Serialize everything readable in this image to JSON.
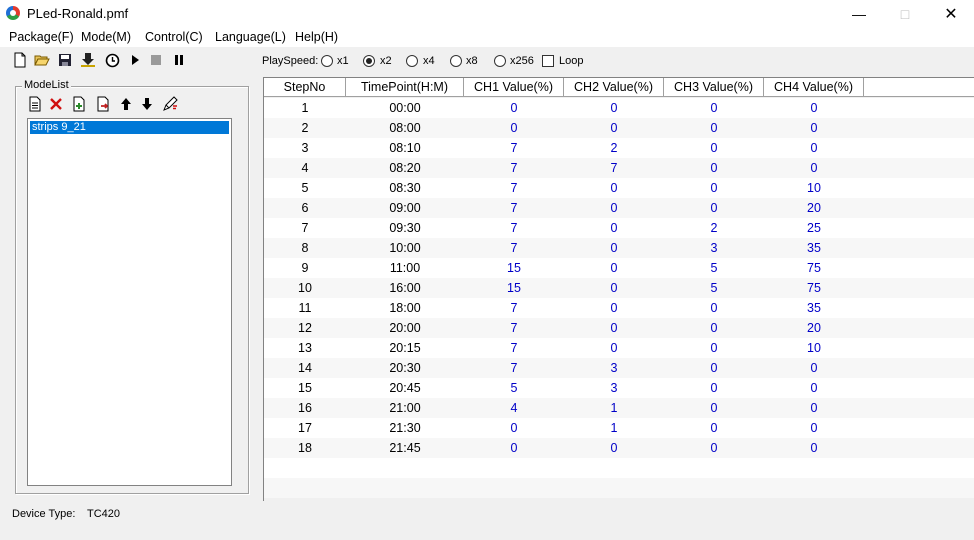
{
  "window": {
    "title": "PLed-Ronald.pmf",
    "min_glyph": "—",
    "max_glyph": "□",
    "close_glyph": "✕"
  },
  "menu": [
    "Package(F)",
    "Mode(M)",
    "Control(C)",
    "Language(L)",
    "Help(H)"
  ],
  "toolbar": {
    "icons": [
      "new-file-icon",
      "open-folder-icon",
      "save-icon",
      "download-icon",
      "timer-icon",
      "play-icon",
      "stop-icon",
      "pause-icon"
    ],
    "playspeed_label": "PlaySpeed:",
    "speeds": [
      "x1",
      "x2",
      "x4",
      "x8",
      "x256"
    ],
    "selected_speed": "x2",
    "loop_label": "Loop",
    "loop_checked": false
  },
  "modelist": {
    "title": "ModeList",
    "tools": [
      "new-mode-icon",
      "delete-icon",
      "import-icon",
      "export-icon",
      "move-up-icon",
      "move-down-icon",
      "edit-icon"
    ],
    "items": [
      "strips 9_21"
    ],
    "selected_index": 0
  },
  "table": {
    "columns": [
      "StepNo",
      "TimePoint(H:M)",
      "CH1 Value(%)",
      "CH2 Value(%)",
      "CH3 Value(%)",
      "CH4 Value(%)"
    ],
    "rows": [
      [
        "1",
        "00:00",
        "0",
        "0",
        "0",
        "0"
      ],
      [
        "2",
        "08:00",
        "0",
        "0",
        "0",
        "0"
      ],
      [
        "3",
        "08:10",
        "7",
        "2",
        "0",
        "0"
      ],
      [
        "4",
        "08:20",
        "7",
        "7",
        "0",
        "0"
      ],
      [
        "5",
        "08:30",
        "7",
        "0",
        "0",
        "10"
      ],
      [
        "6",
        "09:00",
        "7",
        "0",
        "0",
        "20"
      ],
      [
        "7",
        "09:30",
        "7",
        "0",
        "2",
        "25"
      ],
      [
        "8",
        "10:00",
        "7",
        "0",
        "3",
        "35"
      ],
      [
        "9",
        "11:00",
        "15",
        "0",
        "5",
        "75"
      ],
      [
        "10",
        "16:00",
        "15",
        "0",
        "5",
        "75"
      ],
      [
        "11",
        "18:00",
        "7",
        "0",
        "0",
        "35"
      ],
      [
        "12",
        "20:00",
        "7",
        "0",
        "0",
        "20"
      ],
      [
        "13",
        "20:15",
        "7",
        "0",
        "0",
        "10"
      ],
      [
        "14",
        "20:30",
        "7",
        "3",
        "0",
        "0"
      ],
      [
        "15",
        "20:45",
        "5",
        "3",
        "0",
        "0"
      ],
      [
        "16",
        "21:00",
        "4",
        "1",
        "0",
        "0"
      ],
      [
        "17",
        "21:30",
        "0",
        "1",
        "0",
        "0"
      ],
      [
        "18",
        "21:45",
        "0",
        "0",
        "0",
        "0"
      ]
    ]
  },
  "status": {
    "device_type_label": "Device Type:",
    "device_type_value": "TC420"
  },
  "colors": {
    "value_text": "#0000c8",
    "selection": "#0078d7"
  }
}
